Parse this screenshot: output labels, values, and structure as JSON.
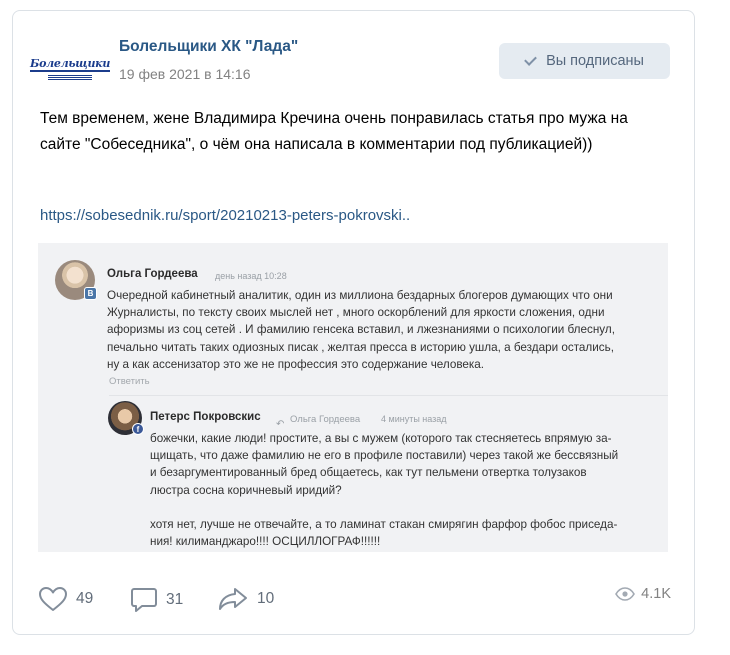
{
  "post": {
    "author": "Болельщики ХК \"Лада\"",
    "date": "19 фев 2021 в 14:16",
    "subscribe_label": "Вы подписаны",
    "text": "Тем временем, жене Владимира Кречина очень понравилась статья про мужа на сайте \"Собеседника\", о чём она написала в комментарии под публикацией))",
    "link": "https://sobesednik.ru/sport/20210213-peters-pokrovski..",
    "avatar_logo_text": "Болельщики"
  },
  "screenshot": {
    "comment1": {
      "author": "Ольга Гордеева",
      "meta": "день назад 10:28",
      "lines": [
        "Очередной кабинетный аналитик, один из миллиона бездарных блогеров думающих что они",
        "Журналисты, по тексту своих мыслей нет , много оскорблений для яркости сложения, одни",
        "афоризмы из соц сетей . И фамилию генсека вставил, и лжезнаниями о психологии блеснул,",
        "печально читать таких одиозных писак , желтая пресса в историю ушла, а бездари остались,",
        "ну а как ассенизатор это же не профессия это содержание человека."
      ],
      "reply_label": "Ответить"
    },
    "comment2": {
      "author": "Петерс Покровскис",
      "reply_to": "Ольга Гордеева",
      "meta": "4 минуты назад",
      "lines": [
        "божечки, какие люди! простите, а вы с мужем (которого так стесняетесь впрямую за-",
        "щищать, что даже фамилию не его в профиле поставили) через такой же бессвязный",
        "и безаргументированный бред общаетесь, как тут пельмени отвертка толузаков",
        "люстра сосна коричневый иридий?",
        "",
        "хотя нет, лучше не отвечайте, а то ламинат стакан смирягин фарфор фобос приседа-",
        "ния! килиманджаро!!!! ОСЦИЛЛОГРАФ!!!!!!"
      ]
    }
  },
  "actions": {
    "likes": "49",
    "comments": "31",
    "shares": "10",
    "views": "4.1K"
  },
  "icons": {
    "like": "heart-icon",
    "comment": "comment-bubble-icon",
    "share": "share-arrow-icon",
    "views": "eye-icon",
    "check": "check-icon",
    "reply": "reply-arrow-icon"
  },
  "colors": {
    "link": "#2a5885",
    "button_bg": "#e5ebf1",
    "button_text": "#55677d",
    "muted": "#828282",
    "action": "#626d7a"
  }
}
